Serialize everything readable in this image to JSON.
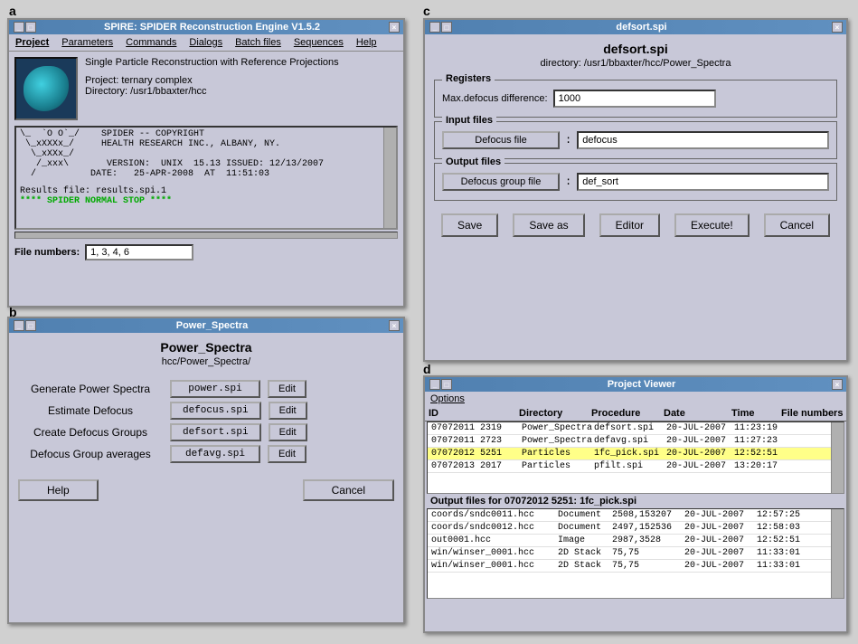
{
  "labels": {
    "a": "a",
    "b": "b",
    "c": "c",
    "d": "d"
  },
  "panelA": {
    "title": "SPIRE: SPIDER Reconstruction Engine V1.5.2",
    "menu": [
      "Project",
      "Parameters",
      "Commands",
      "Dialogs",
      "Batch files",
      "Sequences",
      "Help"
    ],
    "description": "Single Particle Reconstruction with Reference Projections",
    "project": "Project: ternary complex",
    "directory": "Directory: /usr1/bbaxter/hcc",
    "terminal": [
      "\\_  `O O`_/    SPIDER -- COPYRIGHT",
      " \\_xXXXx_/     HEALTH RESEARCH INC., ALBANY, NY.",
      "  \\_xXXx_/",
      "   /_xxx\\       VERSION:  UNIX  15.13 ISSUED: 12/13/2007",
      "  /          DATE:   25-APR-2008  AT  11:51:03"
    ],
    "results_line": "Results file: results.spi.1",
    "stop_line": "**** SPIDER NORMAL STOP ****",
    "file_numbers_label": "File numbers:",
    "file_numbers_value": "1, 3, 4, 6"
  },
  "panelB": {
    "title": "Power_Spectra",
    "titlebar": "Power_Spectra",
    "subtitle": "hcc/Power_Spectra/",
    "rows": [
      {
        "label": "Generate Power Spectra",
        "file": "power.spi",
        "edit": "Edit"
      },
      {
        "label": "Estimate Defocus",
        "file": "defocus.spi",
        "edit": "Edit"
      },
      {
        "label": "Create Defocus Groups",
        "file": "defsort.spi",
        "edit": "Edit"
      },
      {
        "label": "Defocus Group averages",
        "file": "defavg.spi",
        "edit": "Edit"
      }
    ],
    "help_btn": "Help",
    "cancel_btn": "Cancel"
  },
  "panelC": {
    "titlebar": "defsort.spi",
    "title": "defsort.spi",
    "directory": "directory: /usr1/bbaxter/hcc/Power_Spectra",
    "registers": {
      "legend": "Registers",
      "label": "Max.defocus difference:",
      "value": "1000"
    },
    "input_files": {
      "legend": "Input files",
      "label": "Defocus file",
      "colon": ":",
      "value": "defocus"
    },
    "output_files": {
      "legend": "Output files",
      "label": "Defocus group file",
      "colon": ":",
      "value": "def_sort"
    },
    "buttons": {
      "save": "Save",
      "save_as": "Save as",
      "editor": "Editor",
      "execute": "Execute!",
      "cancel": "Cancel"
    }
  },
  "panelD": {
    "titlebar": "Project Viewer",
    "options_menu": "Options",
    "columns": [
      "ID",
      "Directory",
      "Procedure",
      "Date",
      "Time",
      "File numbers"
    ],
    "rows": [
      {
        "id": "07072011 2319",
        "directory": "Power_Spectra",
        "procedure": "defsort.spi",
        "date": "20-JUL-2007",
        "time": "11:23:19",
        "files": ""
      },
      {
        "id": "07072011 2723",
        "directory": "Power_Spectra",
        "procedure": "defavg.spi",
        "date": "20-JUL-2007",
        "time": "11:27:23",
        "files": ""
      },
      {
        "id": "07072012 5251",
        "directory": "Particles",
        "procedure": "1fc_pick.spi",
        "date": "20-JUL-2007",
        "time": "12:52:51",
        "files": "",
        "selected": true
      },
      {
        "id": "07072013 2017",
        "directory": "Particles",
        "procedure": "pfilt.spi",
        "date": "20-JUL-2007",
        "time": "13:20:17",
        "files": ""
      }
    ],
    "details_label": "Output files for 07072012 5251: 1fc_pick.spi",
    "detail_rows": [
      {
        "file": "coords/sndc0011.hcc",
        "type": "Document",
        "d1": "2508,153207",
        "date": "20-JUL-2007",
        "time": "12:57:25"
      },
      {
        "file": "coords/sndc0012.hcc",
        "type": "Document",
        "d1": "2497,152536",
        "date": "20-JUL-2007",
        "time": "12:58:03"
      },
      {
        "file": "out0001.hcc",
        "type": "Image",
        "d1": "2987,3528",
        "date": "20-JUL-2007",
        "time": "12:52:51"
      },
      {
        "file": "win/winser_0001.hcc",
        "type": "2D Stack",
        "d1": "75,75",
        "date": "20-JUL-2007",
        "time": "11:33:01"
      },
      {
        "file": "win/winser_0001.hcc",
        "type": "2D Stack",
        "d1": "75,75",
        "date": "20-JUL-2007",
        "time": "11:33:01"
      }
    ]
  }
}
